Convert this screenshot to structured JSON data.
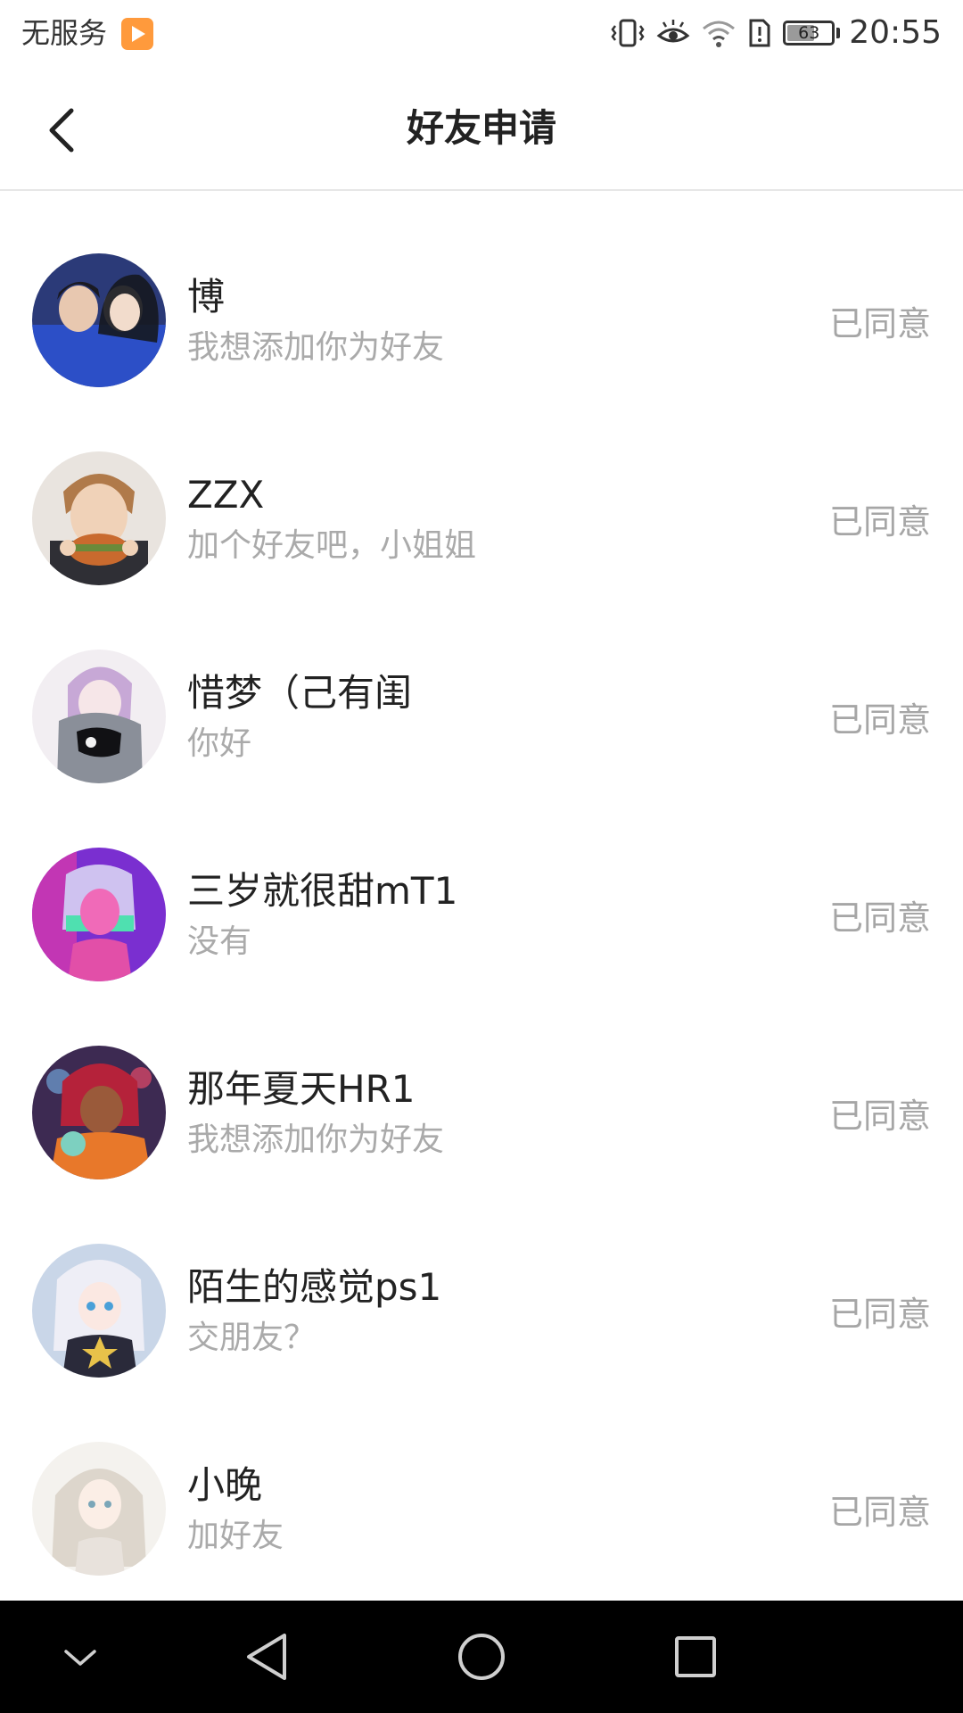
{
  "status_bar": {
    "carrier": "无服务",
    "battery_level": "63",
    "battery_fraction": 0.63,
    "time": "20:55",
    "icons": [
      "app-notification-icon",
      "vibrate-icon",
      "eye-comfort-icon",
      "wifi-icon",
      "sim-alert-icon",
      "battery-icon"
    ]
  },
  "header": {
    "title": "好友申请",
    "back_icon": "back-arrow-icon"
  },
  "requests": [
    {
      "name": "博",
      "message": "我想添加你为好友",
      "status": "已同意"
    },
    {
      "name": "ZZX",
      "message": "加个好友吧，小姐姐",
      "status": "已同意"
    },
    {
      "name": "惜梦（己有闺",
      "message": "你好",
      "status": "已同意"
    },
    {
      "name": "三岁就很甜mT1",
      "message": "没有",
      "status": "已同意"
    },
    {
      "name": "那年夏天HR1",
      "message": "我想添加你为好友",
      "status": "已同意"
    },
    {
      "name": "陌生的感觉ps1",
      "message": "交朋友？",
      "status": "已同意"
    },
    {
      "name": "小晚",
      "message": "加好友",
      "status": "已同意"
    }
  ],
  "nav_bar": {
    "buttons": [
      "collapse-icon",
      "back-triangle-icon",
      "home-circle-icon",
      "recents-square-icon"
    ]
  },
  "colors": {
    "background": "#ffffff",
    "text_primary": "#222222",
    "text_secondary": "#aaaaaa",
    "status_text": "#a6a6a6",
    "divider": "#e6e6e6",
    "nav_bar": "#000000"
  }
}
